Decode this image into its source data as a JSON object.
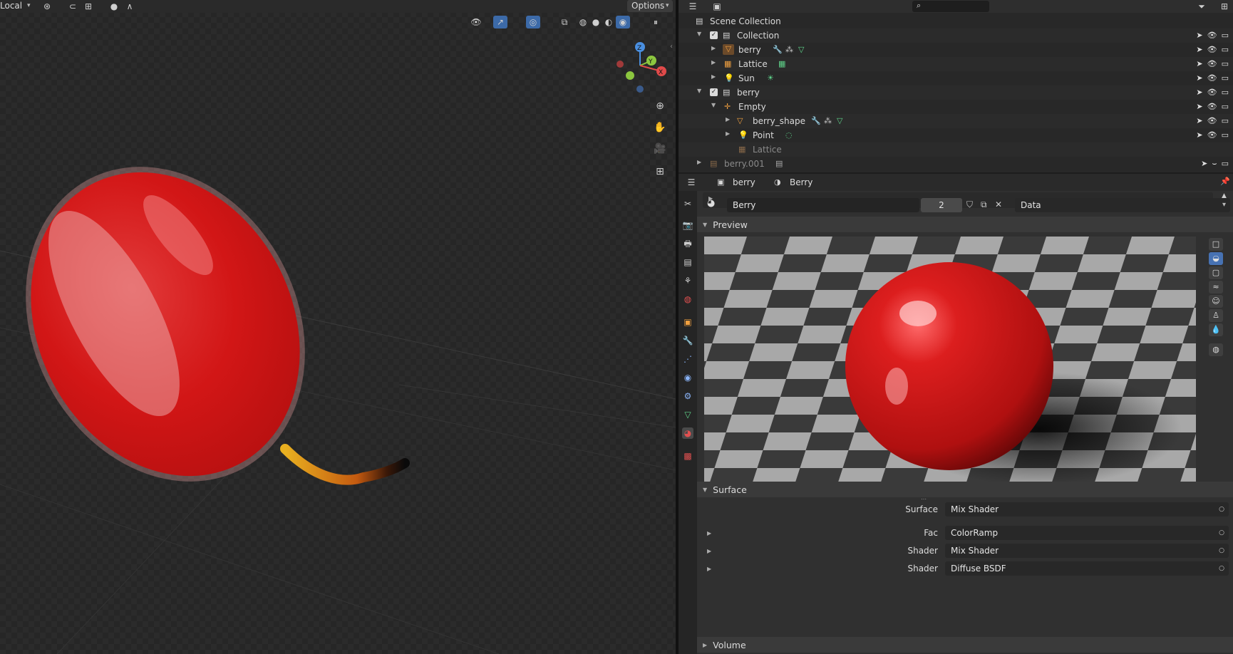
{
  "viewport": {
    "header": {
      "orientation": "Local",
      "options_label": "Options"
    },
    "gizmo": {
      "z": "Z",
      "y": "Y",
      "x": "X"
    }
  },
  "outliner": {
    "rows": [
      {
        "label": "Scene Collection",
        "icon": "collection-icon"
      },
      {
        "label": "Collection",
        "icon": "collection-icon"
      },
      {
        "label": "berry",
        "icon": "mesh-icon"
      },
      {
        "label": "Lattice",
        "icon": "lattice-icon"
      },
      {
        "label": "Sun",
        "icon": "light-icon"
      },
      {
        "label": "berry",
        "icon": "collection-icon"
      },
      {
        "label": "Empty",
        "icon": "empty-icon"
      },
      {
        "label": "berry_shape",
        "icon": "mesh-icon"
      },
      {
        "label": "Point",
        "icon": "light-icon"
      },
      {
        "label": "Lattice",
        "icon": "lattice-icon"
      },
      {
        "label": "berry.001",
        "icon": "collection-icon"
      }
    ]
  },
  "properties": {
    "breadcrumb": {
      "object": "berry",
      "material": "Berry"
    },
    "material": {
      "name": "Berry",
      "users": "2",
      "link": "Data"
    },
    "panels": {
      "preview": "Preview",
      "surface": "Surface",
      "volume": "Volume"
    },
    "surface_fields": [
      {
        "label": "Surface",
        "value": "Mix Shader"
      },
      {
        "label": "Fac",
        "value": "ColorRamp"
      },
      {
        "label": "Shader",
        "value": "Mix Shader"
      },
      {
        "label": "Shader",
        "value": "Diffuse BSDF"
      }
    ]
  },
  "colors": {
    "accent": "#4772b3",
    "berry_red": "#d01818",
    "bg": "#303030"
  }
}
